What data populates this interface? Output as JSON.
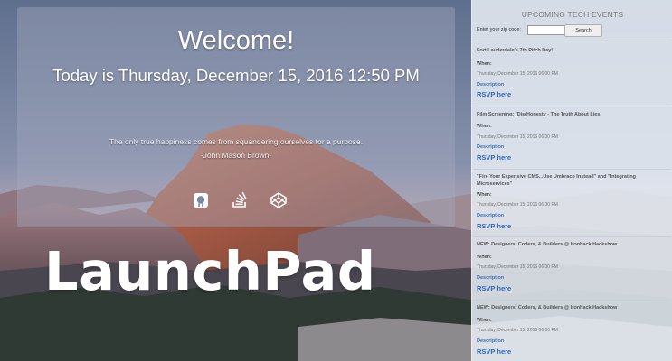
{
  "welcome": {
    "title": "Welcome!",
    "today": "Today is Thursday, December 15, 2016 12:50 PM",
    "quote": "The only true happiness comes from squandering ourselves for a purpose.",
    "author": "-John Mason Brown-"
  },
  "social": [
    {
      "icon": "github-icon"
    },
    {
      "icon": "stackoverflow-icon"
    },
    {
      "icon": "codepen-icon"
    }
  ],
  "brand": "LaunchPad",
  "events_panel": {
    "heading": "UPCOMING TECH EVENTS",
    "zip_label": "Enter your zip code:",
    "zip_value": "",
    "search_label": "Search",
    "when_label": "When:",
    "description_label": "Description",
    "rsvp_label": "RSVP here",
    "events": [
      {
        "title": "Fort Lauderdale's 7th Pitch Day!",
        "date": "Thursday, December 15, 2016 06:00 PM"
      },
      {
        "title": "Film Screening: (Dis)Honesty - The Truth About Lies",
        "date": "Thursday, December 15, 2016 06:30 PM"
      },
      {
        "title": "\"Fire Your Expensive CMS...Use Umbraco Instead\" and \"Integrating Microservices\"",
        "date": "Thursday, December 15, 2016 06:30 PM"
      },
      {
        "title": "NEW: Designers, Coders, & Builders @ Ironhack Hackshow",
        "date": "Thursday, December 15, 2016 06:30 PM"
      },
      {
        "title": "NEW: Designers, Coders, & Builders @ Ironhack Hackshow",
        "date": "Thursday, December 15, 2016 06:30 PM"
      }
    ]
  }
}
